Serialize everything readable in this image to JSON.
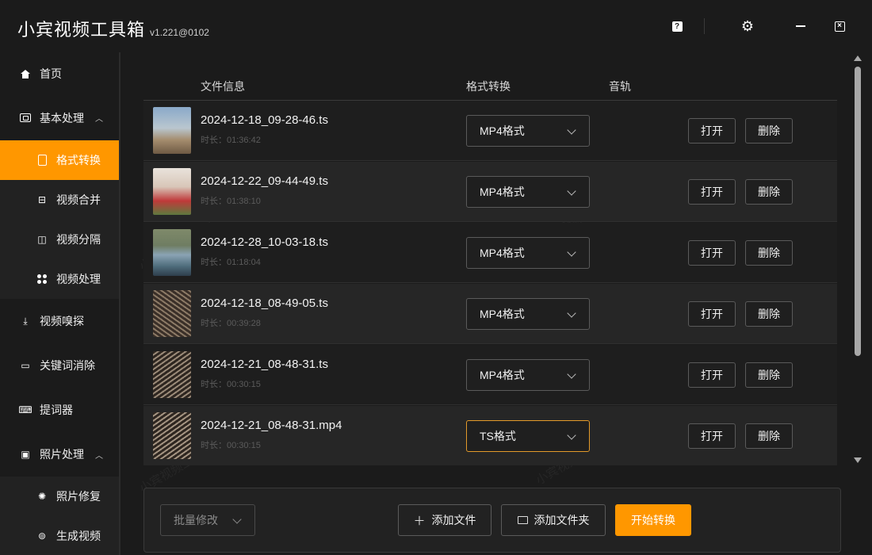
{
  "app": {
    "title": "小宾视频工具箱",
    "version": "v1.221@0102"
  },
  "titlebar": {
    "help_icon": "help-icon",
    "settings_icon": "gear-icon",
    "minimize_icon": "minimize-icon",
    "close_icon": "close-icon"
  },
  "sidebar": {
    "items": [
      {
        "label": "首页",
        "icon": "home-icon"
      },
      {
        "label": "基本处理",
        "icon": "box-icon"
      },
      {
        "label": "格式转换",
        "icon": "document-icon"
      },
      {
        "label": "视频合并",
        "icon": "merge-icon"
      },
      {
        "label": "视频分隔",
        "icon": "split-icon"
      },
      {
        "label": "视频处理",
        "icon": "process-icon"
      },
      {
        "label": "视频嗅探",
        "icon": "download-icon"
      },
      {
        "label": "关键词消除",
        "icon": "subtitle-icon"
      },
      {
        "label": "提词器",
        "icon": "keyboard-icon"
      },
      {
        "label": "照片处理",
        "icon": "photo-icon"
      },
      {
        "label": "照片修复",
        "icon": "repair-icon"
      },
      {
        "label": "生成视频",
        "icon": "generate-icon"
      }
    ],
    "active_item": "格式转换"
  },
  "table": {
    "headers": {
      "file_info": "文件信息",
      "format": "格式转换",
      "audio": "音轨"
    },
    "rows": [
      {
        "name": "2024-12-18_09-28-46.ts",
        "duration": "时长：01:36:42",
        "format": "MP4格式",
        "open": "打开",
        "delete": "删除"
      },
      {
        "name": "2024-12-22_09-44-49.ts",
        "duration": "时长：01:38:10",
        "format": "MP4格式",
        "open": "打开",
        "delete": "删除"
      },
      {
        "name": "2024-12-28_10-03-18.ts",
        "duration": "时长：01:18:04",
        "format": "MP4格式",
        "open": "打开",
        "delete": "删除"
      },
      {
        "name": "2024-12-18_08-49-05.ts",
        "duration": "时长：00:39:28",
        "format": "MP4格式",
        "open": "打开",
        "delete": "删除"
      },
      {
        "name": "2024-12-21_08-48-31.ts",
        "duration": "时长：00:30:15",
        "format": "MP4格式",
        "open": "打开",
        "delete": "删除"
      },
      {
        "name": "2024-12-21_08-48-31.mp4",
        "duration": "时长：00:30:15",
        "format": "TS格式",
        "open": "打开",
        "delete": "删除"
      }
    ]
  },
  "actions": {
    "batch_modify": "批量修改",
    "add_file": "添加文件",
    "add_folder": "添加文件夹",
    "start_convert": "开始转换"
  },
  "watermark": "小宾视频工具箱",
  "colors": {
    "accent": "#ff9700",
    "background": "#1b1b1b",
    "selected_border": "#e39a2a"
  }
}
